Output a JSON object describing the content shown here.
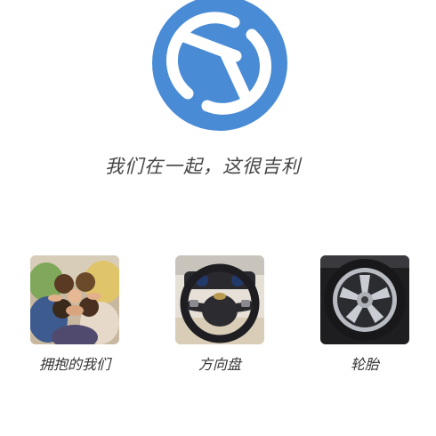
{
  "slogan": "我们在一起，这很吉利",
  "brand_color": "#4a8bd6",
  "categories": [
    {
      "label": "拥抱的我们",
      "image": "group-hug-photo"
    },
    {
      "label": "方向盘",
      "image": "steering-wheel-photo"
    },
    {
      "label": "轮胎",
      "image": "tire-photo"
    }
  ]
}
